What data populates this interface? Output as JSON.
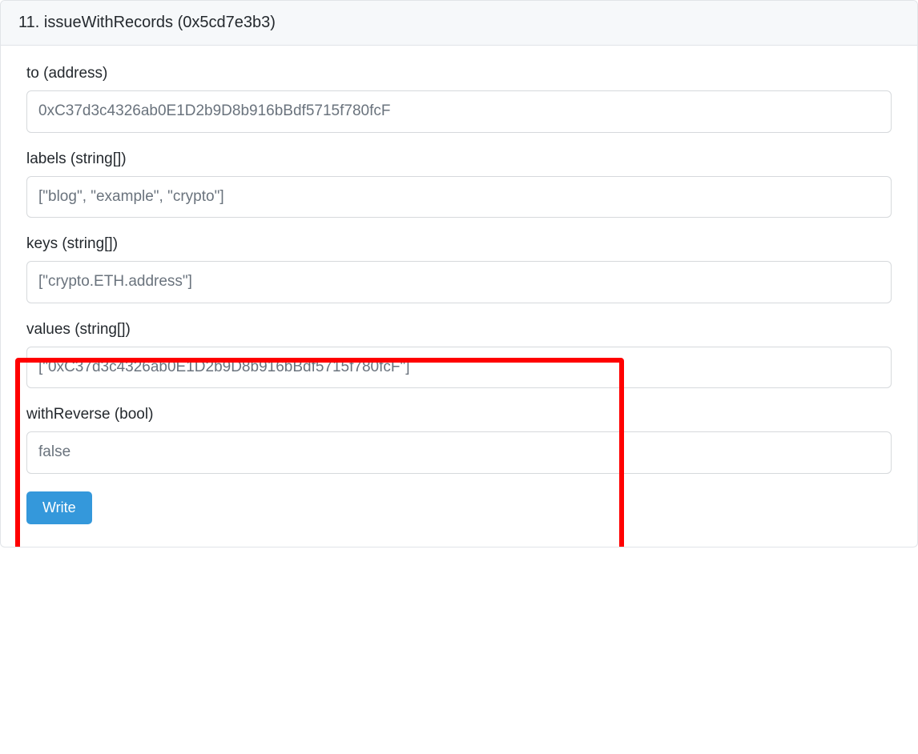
{
  "panel": {
    "header": "11. issueWithRecords (0x5cd7e3b3)"
  },
  "fields": {
    "to": {
      "label": "to (address)",
      "value": "0xC37d3c4326ab0E1D2b9D8b916bBdf5715f780fcF"
    },
    "labels": {
      "label": "labels (string[])",
      "value": "[\"blog\", \"example\", \"crypto\"]"
    },
    "keys": {
      "label": "keys (string[])",
      "value": "[\"crypto.ETH.address\"]"
    },
    "values": {
      "label": "values (string[])",
      "value": "[\"0xC37d3c4326ab0E1D2b9D8b916bBdf5715f780fcF\"]"
    },
    "withReverse": {
      "label": "withReverse (bool)",
      "value": "false"
    }
  },
  "actions": {
    "write": "Write"
  }
}
